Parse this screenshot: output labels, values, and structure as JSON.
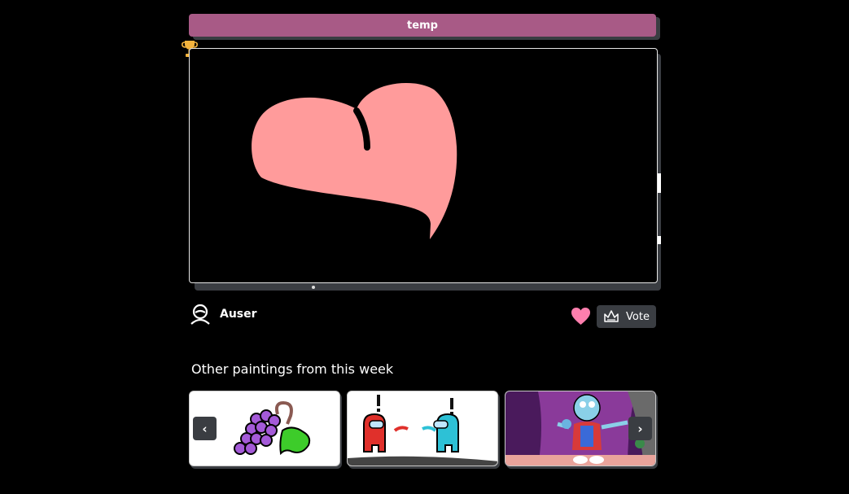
{
  "painting": {
    "title": "temp",
    "author": "Auser",
    "vote_label": "Vote",
    "fill_color": "#ff9b9b"
  },
  "icons": {
    "trophy": "trophy-icon",
    "avatar": "user-avatar-icon",
    "like": "heart-icon",
    "vote": "crown-icon",
    "prev": "chevron-left-icon",
    "next": "chevron-right-icon"
  },
  "carousel": {
    "heading": "Other paintings from this week",
    "prev_label": "‹",
    "next_label": "›",
    "items": [
      {
        "name": "thumb-grapes"
      },
      {
        "name": "thumb-among-us"
      },
      {
        "name": "thumb-cartoon"
      }
    ]
  },
  "colors": {
    "accent": "#a85a86",
    "heart": "#ff7fae",
    "button_bg": "#3a3d42",
    "trophy": "#f3b33d"
  }
}
